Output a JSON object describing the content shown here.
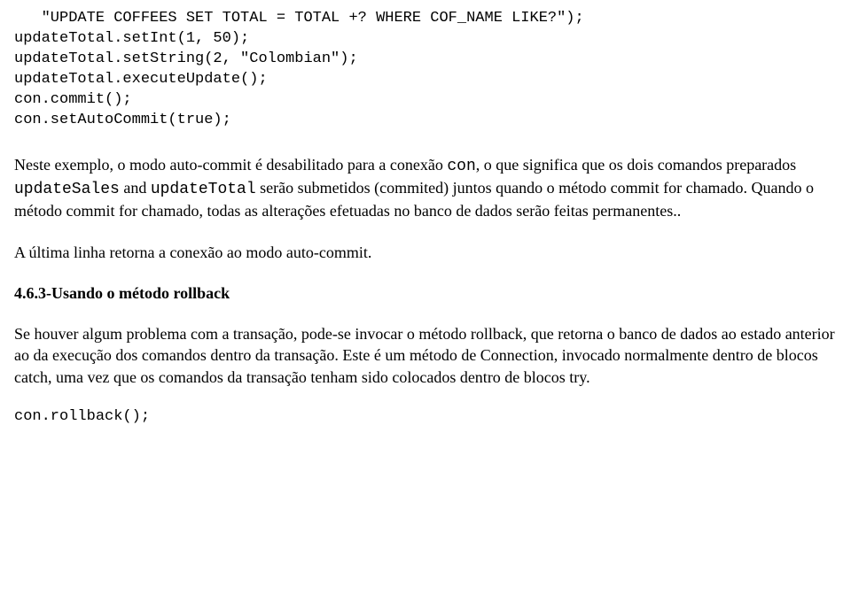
{
  "code_block1": {
    "l1": "   \"UPDATE COFFEES SET TOTAL = TOTAL +? WHERE COF_NAME LIKE?\");",
    "l2": "updateTotal.setInt(1, 50);",
    "l3": "updateTotal.setString(2, \"Colombian\");",
    "l4": "updateTotal.executeUpdate();",
    "l5": "con.commit();",
    "l6": "con.setAutoCommit(true);"
  },
  "para1": {
    "t1": "Neste exemplo, o modo auto-commit é desabilitado para a conexão ",
    "c1": "con",
    "t2": ", o que significa que os dois comandos preparados ",
    "c2": "updateSales",
    "t3": " and ",
    "c3": "updateTotal",
    "t4": " serão submetidos (commited) juntos quando o método commit for chamado. Quando o método commit for chamado, todas as alterações efetuadas no banco de dados serão feitas permanentes.."
  },
  "para2": "A última linha retorna a conexão ao modo auto-commit.",
  "heading": "4.6.3-Usando o método rollback",
  "para3": "Se houver algum problema com a transação, pode-se invocar o método rollback, que retorna o banco de dados ao estado anterior ao da execução dos comandos dentro da transação. Este é um método de Connection, invocado normalmente dentro de blocos catch, uma vez que os comandos da transação tenham sido colocados dentro de blocos try.",
  "code_block2": "con.rollback();"
}
